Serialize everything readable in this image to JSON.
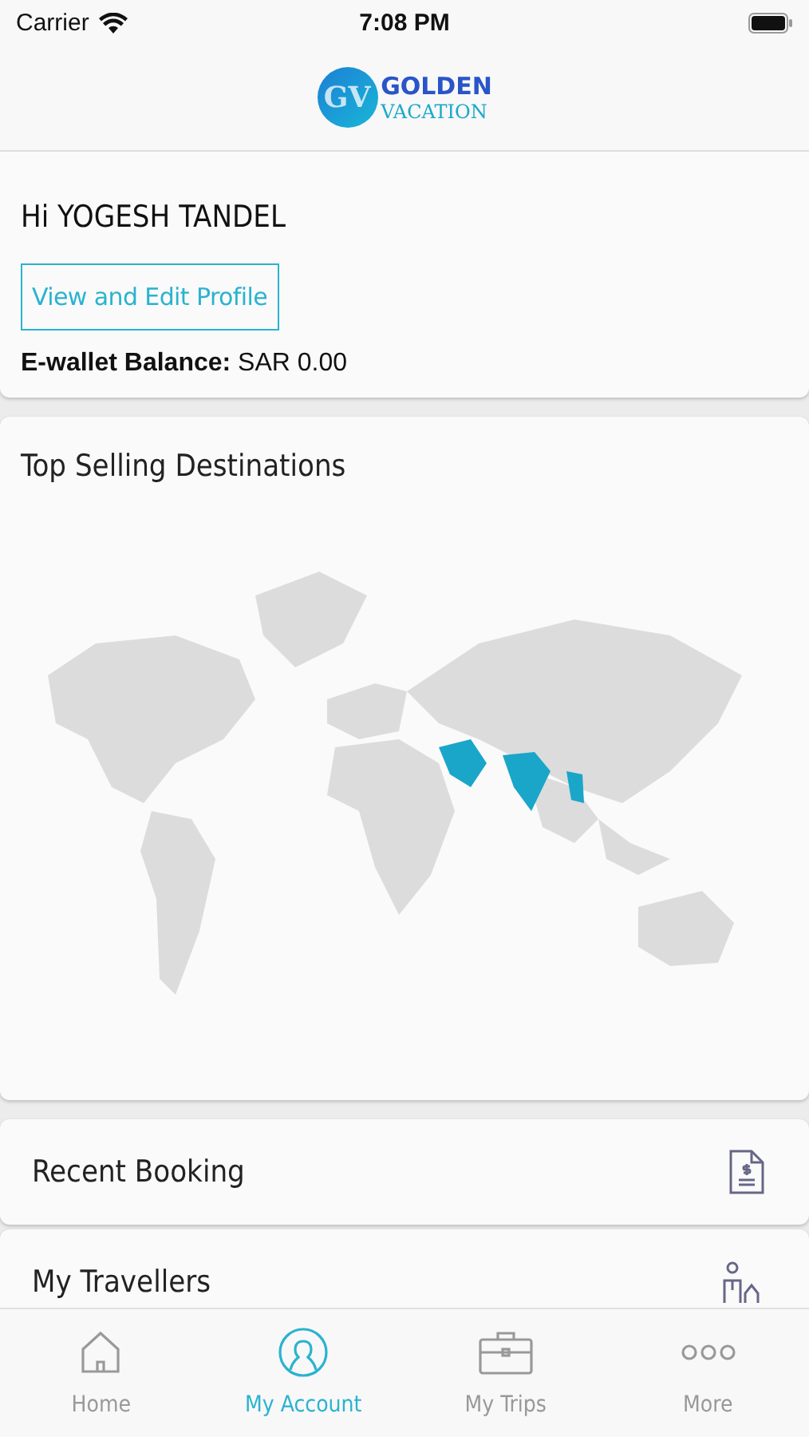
{
  "status_bar": {
    "carrier": "Carrier",
    "time": "7:08 PM"
  },
  "logo": {
    "monogram": "GV",
    "line1": "GOLDEN",
    "line2": "VACATION"
  },
  "profile": {
    "greeting": "Hi YOGESH TANDEL",
    "edit_button": "View and Edit Profile",
    "wallet_label": "E-wallet Balance:",
    "wallet_value": "SAR 0.00"
  },
  "destinations": {
    "title": "Top Selling Destinations"
  },
  "menu": [
    {
      "label": "Recent Booking",
      "kind": "invoice"
    },
    {
      "label": "My Travellers",
      "kind": "travellers"
    }
  ],
  "tabs": [
    {
      "label": "Home",
      "kind": "home",
      "selected": false
    },
    {
      "label": "My Account",
      "kind": "account",
      "selected": true
    },
    {
      "label": "My Trips",
      "kind": "trips",
      "selected": false
    },
    {
      "label": "More",
      "kind": "more",
      "selected": false
    }
  ]
}
